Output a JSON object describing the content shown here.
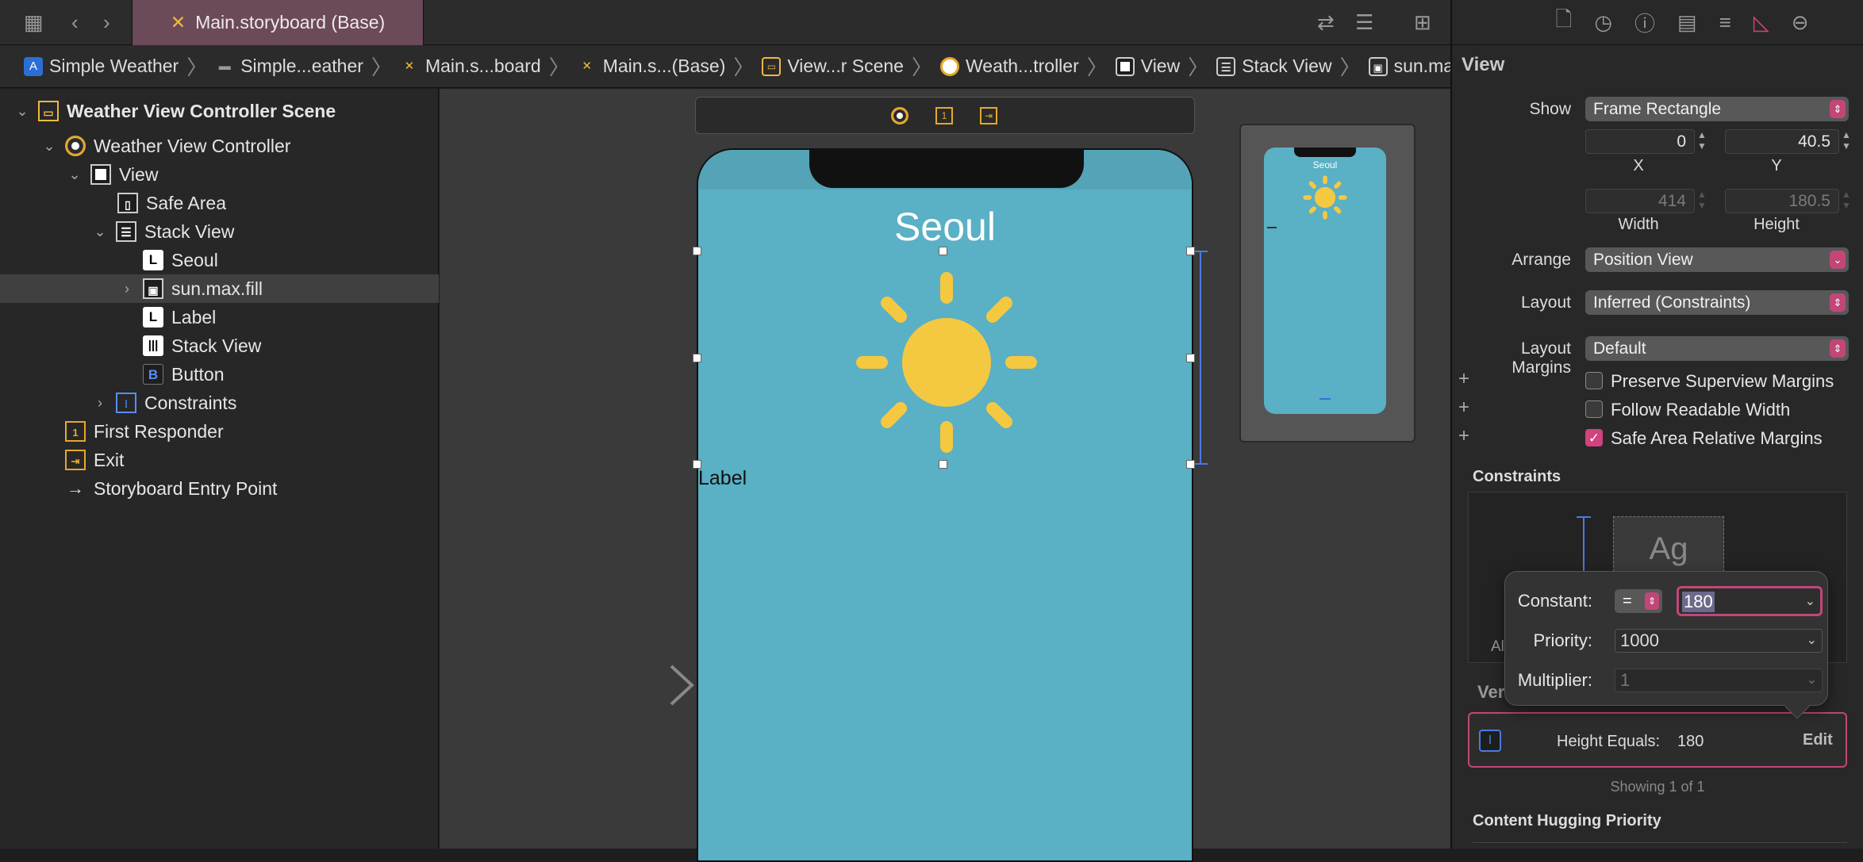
{
  "tab": {
    "title": "Main.storyboard (Base)"
  },
  "breadcrumb": [
    "Simple Weather",
    "Simple...eather",
    "Main.s...board",
    "Main.s...(Base)",
    "View...r Scene",
    "Weath...troller",
    "View",
    "Stack View",
    "sun.max.fill"
  ],
  "navigator": {
    "scene": "Weather View Controller Scene",
    "controller": "Weather View Controller",
    "view": "View",
    "safe_area": "Safe Area",
    "stack_view": "Stack View",
    "seoul": "Seoul",
    "sun": "sun.max.fill",
    "label": "Label",
    "inner_stack": "Stack View",
    "button": "Button",
    "constraints": "Constraints",
    "first_responder": "First Responder",
    "exit": "Exit",
    "entry_point": "Storyboard Entry Point"
  },
  "canvas": {
    "city": "Seoul",
    "label": "Label",
    "mini_city": "Seoul"
  },
  "inspector": {
    "title": "View",
    "show_label": "Show",
    "show_value": "Frame Rectangle",
    "x": "0",
    "x_label": "X",
    "y": "40.5",
    "y_label": "Y",
    "width": "414",
    "width_label": "Width",
    "height": "180.5",
    "height_label": "Height",
    "arrange_label": "Arrange",
    "arrange_value": "Position View",
    "layout_label": "Layout",
    "layout_value": "Inferred (Constraints)",
    "margins_label": "Layout Margins",
    "margins_value": "Default",
    "preserve": "Preserve Superview Margins",
    "readable": "Follow Readable Width",
    "safe_area": "Safe Area Relative Margins",
    "constraints_title": "Constraints",
    "ag": "Ag",
    "partial_left": "Al",
    "partial_section": "Ver",
    "height_equals": "Height Equals:",
    "height_value": "180",
    "edit": "Edit",
    "showing": "Showing 1 of 1",
    "hugging_title": "Content Hugging Priority"
  },
  "popover": {
    "constant_label": "Constant:",
    "relation": "=",
    "constant_value": "180",
    "priority_label": "Priority:",
    "priority_value": "1000",
    "multiplier_label": "Multiplier:",
    "multiplier_value": "1"
  },
  "colors": {
    "accent": "#c24678",
    "sky": "#5ab0c4",
    "sun": "#f5c842"
  }
}
